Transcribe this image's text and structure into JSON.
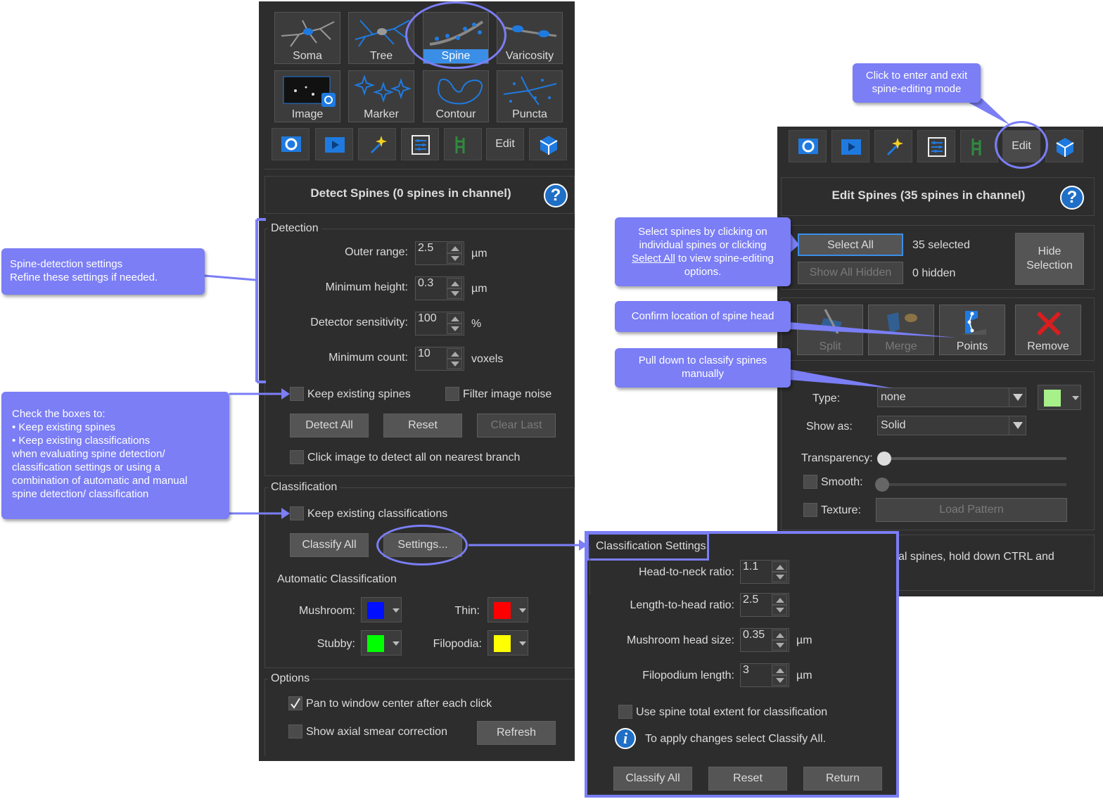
{
  "colors": {
    "panel": "#2d2d2d",
    "accent": "#3a8ee6",
    "callout": "#7b7ef5",
    "highlight": "#7b7ef5",
    "mushroom": "#0010ff",
    "thin": "#ff0000",
    "stubby": "#00ff00",
    "filopodia": "#ffff00",
    "type_color": "#a8f08a"
  },
  "objects": {
    "soma": "Soma",
    "tree": "Tree",
    "spine": "Spine",
    "varicosity": "Varicosity",
    "image": "Image",
    "marker": "Marker",
    "contour": "Contour",
    "puncta": "Puncta"
  },
  "toolbar": {
    "edit": "Edit",
    "icons": [
      "display-settings-icon",
      "movie-icon",
      "magic-wand-icon",
      "sliders-icon",
      "graph-icon",
      "cube-icon"
    ]
  },
  "detect": {
    "header": "Detect Spines (0 spines in channel)",
    "help": "?",
    "detection_legend": "Detection",
    "outer_range_label": "Outer range:",
    "outer_range_value": "2.5",
    "outer_range_unit": "µm",
    "min_height_label": "Minimum height:",
    "min_height_value": "0.3",
    "min_height_unit": "µm",
    "sensitivity_label": "Detector sensitivity:",
    "sensitivity_value": "100",
    "sensitivity_unit": "%",
    "min_count_label": "Minimum count:",
    "min_count_value": "10",
    "min_count_unit": "voxels",
    "keep_spines": "Keep existing spines",
    "filter_noise": "Filter image noise",
    "detect_all": "Detect All",
    "reset": "Reset",
    "clear_last": "Clear Last",
    "click_image": "Click image to detect all on nearest branch",
    "classification_legend": "Classification",
    "keep_classifications": "Keep existing classifications",
    "classify_all": "Classify All",
    "settings": "Settings...",
    "auto_class": "Automatic Classification",
    "mushroom": "Mushroom:",
    "thin": "Thin:",
    "stubby": "Stubby:",
    "filopodia": "Filopodia:",
    "options_legend": "Options",
    "pan": "Pan to window center after each click",
    "pan_checked": true,
    "axial": "Show axial smear correction",
    "refresh": "Refresh"
  },
  "edit": {
    "header": "Edit Spines (35 spines in channel)",
    "select_all": "Select All",
    "selected": "35 selected",
    "show_hidden": "Show All Hidden",
    "hidden": "0 hidden",
    "hide_selection": "Hide Selection",
    "split": "Split",
    "merge": "Merge",
    "points": "Points",
    "remove": "Remove",
    "type_label": "Type:",
    "type_value": "none",
    "show_as_label": "Show as:",
    "show_as_value": "Solid",
    "transparency": "Transparency:",
    "smooth": "Smooth:",
    "texture": "Texture:",
    "load_pattern": "Load Pattern",
    "hint_partial": "al spines, hold down CTRL and"
  },
  "class_settings": {
    "legend": "Classification Settings",
    "head_neck_label": "Head-to-neck ratio:",
    "head_neck_value": "1.1",
    "len_head_label": "Length-to-head ratio:",
    "len_head_value": "2.5",
    "mush_head_label": "Mushroom head size:",
    "mush_head_value": "0.35",
    "mush_head_unit": "µm",
    "filo_len_label": "Filopodium length:",
    "filo_len_value": "3",
    "filo_len_unit": "µm",
    "use_total": "Use spine total extent for classification",
    "info": "To apply changes select Classify All.",
    "classify_all": "Classify All",
    "reset": "Reset",
    "return": "Return"
  },
  "callouts": {
    "detection": [
      "Spine-detection settings",
      "Refine these settings if needed."
    ],
    "boxes": [
      "Check the boxes to:",
      "• Keep existing spines",
      "• Keep existing classifications",
      "when evaluating spine detection/",
      "classification settings or using a",
      "combination of automatic and manual",
      "spine detection/ classification"
    ],
    "edit_mode": [
      "Click to enter and exit",
      "spine-editing mode"
    ],
    "select_pre": "Select spines by clicking on individual spines or clicking ",
    "select_link": "Select All",
    "select_post": " to view spine-editing options.",
    "confirm": "Confirm location of spine head",
    "pull_down": "Pull down to classify spines manually"
  }
}
